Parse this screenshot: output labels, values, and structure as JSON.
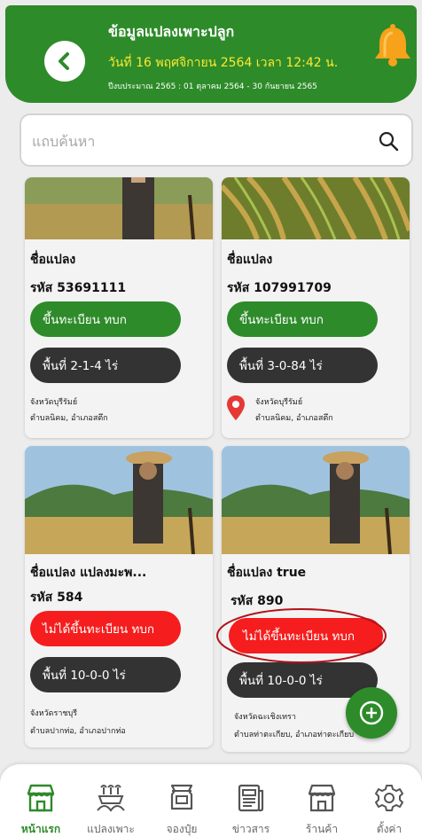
{
  "header": {
    "title": "ข้อมูลแปลงเพาะปลูก",
    "date": "วันที่ 16 พฤศจิกายน 2564 เวลา 12:42 น.",
    "budget_year": "ปีงบประมาณ 2565 : 01 ตุลาคม 2564 - 30 กันยายน 2565"
  },
  "search": {
    "placeholder": "แถบค้นหา"
  },
  "cards": [
    {
      "name": "ชื่อแปลง",
      "code": "รหัส 53691111",
      "status": "ขึ้นทะเบียน ทบก",
      "area": "พื้นที่ 2-1-4 ไร่",
      "province": "จังหวัดบุรีรัมย์",
      "district": "ตำบลนิคม, อำเภอสตึก"
    },
    {
      "name": "ชื่อแปลง",
      "code": "รหัส 107991709",
      "status": "ขึ้นทะเบียน ทบก",
      "area": "พื้นที่ 3-0-84 ไร่",
      "province": "จังหวัดบุรีรัมย์",
      "district": "ตำบลนิคม, อำเภอสตึก"
    },
    {
      "name": "ชื่อแปลง แปลงมะพ...",
      "code": "รหัส 584",
      "status": "ไม่ได้ขึ้นทะเบียน ทบก",
      "area": "พื้นที่ 10-0-0 ไร่",
      "province": "จังหวัดราชบุรี",
      "district": "ตำบลปากท่อ, อำเภอปากท่อ"
    },
    {
      "name": "ชื่อแปลง true",
      "code": "รหัส 890",
      "status": "ไม่ได้ขึ้นทะเบียน ทบก",
      "area": "พื้นที่ 10-0-0 ไร่",
      "province": "จังหวัดฉะเชิงเทรา",
      "district": "ตำบลท่าตะเกียบ, อำเภอท่าตะเกียบ"
    }
  ],
  "nav": [
    {
      "label": "หน้าแรก",
      "icon": "store-icon"
    },
    {
      "label": "แปลงเพาะ",
      "icon": "plant-plot-icon"
    },
    {
      "label": "จองปุ๋ย",
      "icon": "fertilizer-sack-icon"
    },
    {
      "label": "ข่าวสาร",
      "icon": "news-icon"
    },
    {
      "label": "ร้านค้า",
      "icon": "shop-icon"
    },
    {
      "label": "ตั้งค่า",
      "icon": "gear-icon"
    }
  ],
  "colors": {
    "primary_green": "#2e8b2a",
    "alert_red": "#f51d1d",
    "dark_pill": "#333333",
    "date_yellow": "#ffe82e"
  }
}
